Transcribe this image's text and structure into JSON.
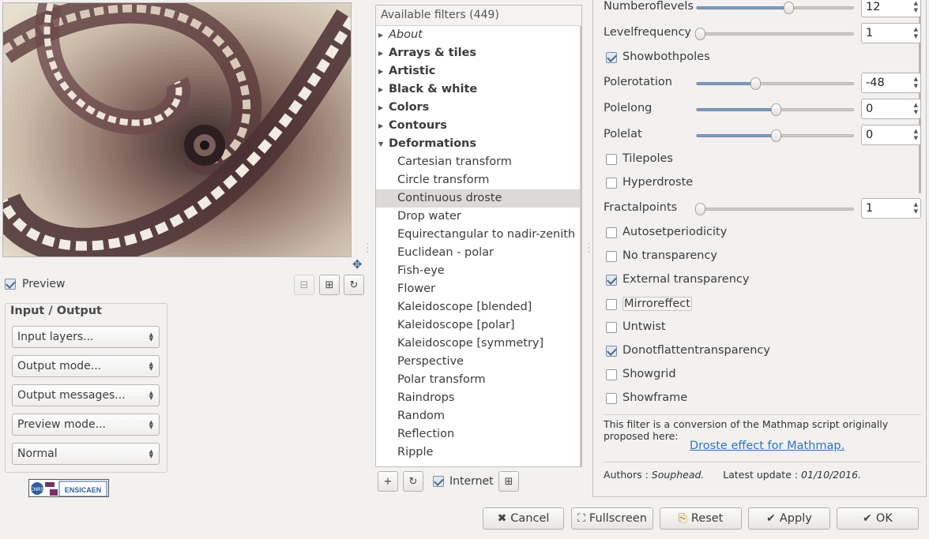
{
  "preview": {
    "checkbox_label": "Preview",
    "checked": true
  },
  "io_group": {
    "title": "Input / Output",
    "combos": [
      "Input layers...",
      "Output mode...",
      "Output messages...",
      "Preview mode...",
      "Normal"
    ]
  },
  "logos": {
    "ensicaen": "ENSICAEN",
    "cnrs": "CNRS"
  },
  "filters": {
    "header": "Available filters (449)",
    "tree": [
      {
        "label": "About",
        "kind": "cat-italic"
      },
      {
        "label": "Arrays & tiles",
        "kind": "cat"
      },
      {
        "label": "Artistic",
        "kind": "cat"
      },
      {
        "label": "Black & white",
        "kind": "cat"
      },
      {
        "label": "Colors",
        "kind": "cat"
      },
      {
        "label": "Contours",
        "kind": "cat"
      },
      {
        "label": "Deformations",
        "kind": "cat-open"
      },
      {
        "label": "Cartesian transform",
        "kind": "child"
      },
      {
        "label": "Circle transform",
        "kind": "child"
      },
      {
        "label": "Continuous droste",
        "kind": "child-selected"
      },
      {
        "label": "Drop water",
        "kind": "child"
      },
      {
        "label": "Equirectangular to nadir-zenith",
        "kind": "child"
      },
      {
        "label": "Euclidean - polar",
        "kind": "child"
      },
      {
        "label": "Fish-eye",
        "kind": "child"
      },
      {
        "label": "Flower",
        "kind": "child"
      },
      {
        "label": "Kaleidoscope [blended]",
        "kind": "child"
      },
      {
        "label": "Kaleidoscope [polar]",
        "kind": "child"
      },
      {
        "label": "Kaleidoscope [symmetry]",
        "kind": "child"
      },
      {
        "label": "Perspective",
        "kind": "child"
      },
      {
        "label": "Polar transform",
        "kind": "child"
      },
      {
        "label": "Raindrops",
        "kind": "child"
      },
      {
        "label": "Random",
        "kind": "child"
      },
      {
        "label": "Reflection",
        "kind": "child"
      },
      {
        "label": "Ripple",
        "kind": "child"
      }
    ],
    "internet_label": "Internet",
    "internet_checked": true
  },
  "params": {
    "sliders": [
      {
        "label": "Numberoflevels",
        "value": "12",
        "fraction": 0.58
      },
      {
        "label": "Levelfrequency",
        "value": "1",
        "fraction": 0.02
      },
      {
        "label": "Polerotation",
        "value": "-48",
        "fraction": 0.37
      },
      {
        "label": "Polelong",
        "value": "0",
        "fraction": 0.5
      },
      {
        "label": "Polelat",
        "value": "0",
        "fraction": 0.5
      },
      {
        "label": "Fractalpoints",
        "value": "1",
        "fraction": 0.02
      }
    ],
    "checkboxes": [
      {
        "label": "Showbothpoles",
        "checked": true
      },
      {
        "label": "Tilepoles",
        "checked": false
      },
      {
        "label": "Hyperdroste",
        "checked": false
      },
      {
        "label": "Autosetperiodicity",
        "checked": false
      },
      {
        "label": "No transparency",
        "checked": false
      },
      {
        "label": "External transparency",
        "checked": true
      },
      {
        "label": "Mirroreffect",
        "checked": false
      },
      {
        "label": "Untwist",
        "checked": false
      },
      {
        "label": "Donotflattentransparency",
        "checked": true
      },
      {
        "label": "Showgrid",
        "checked": false
      },
      {
        "label": "Showframe",
        "checked": false
      }
    ],
    "description": "This filter is a conversion of the Mathmap script originally proposed here:",
    "link": "Droste effect for Mathmap.",
    "authors_prefix": "Authors : ",
    "authors_name": "Souphead.",
    "update_prefix": "Latest update : ",
    "update_date": "01/10/2016."
  },
  "buttons": {
    "cancel": "Cancel",
    "fullscreen": "Fullscreen",
    "reset": "Reset",
    "apply": "Apply",
    "ok": "OK"
  },
  "colors": {
    "accent": "#7e9cc0",
    "link": "#2a76c6",
    "selection": "#dcdad6"
  }
}
